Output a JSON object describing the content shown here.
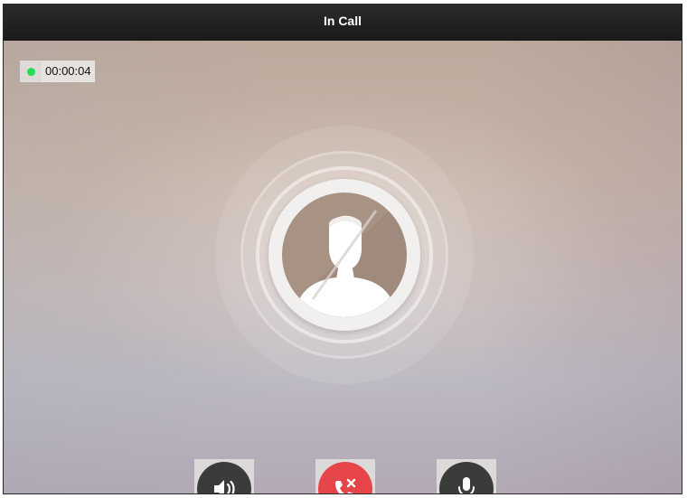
{
  "window": {
    "title": "In Call"
  },
  "call": {
    "status_color": "#22dd55",
    "elapsed": "00:00:04"
  },
  "avatar": {
    "icon": "user-placeholder-icon"
  },
  "controls": {
    "speaker": {
      "icon": "speaker-icon",
      "color": "#3b3b3b"
    },
    "hangup": {
      "icon": "hang-up-icon",
      "color": "#e6464a"
    },
    "mic": {
      "icon": "microphone-icon",
      "color": "#3b3b3b"
    }
  }
}
